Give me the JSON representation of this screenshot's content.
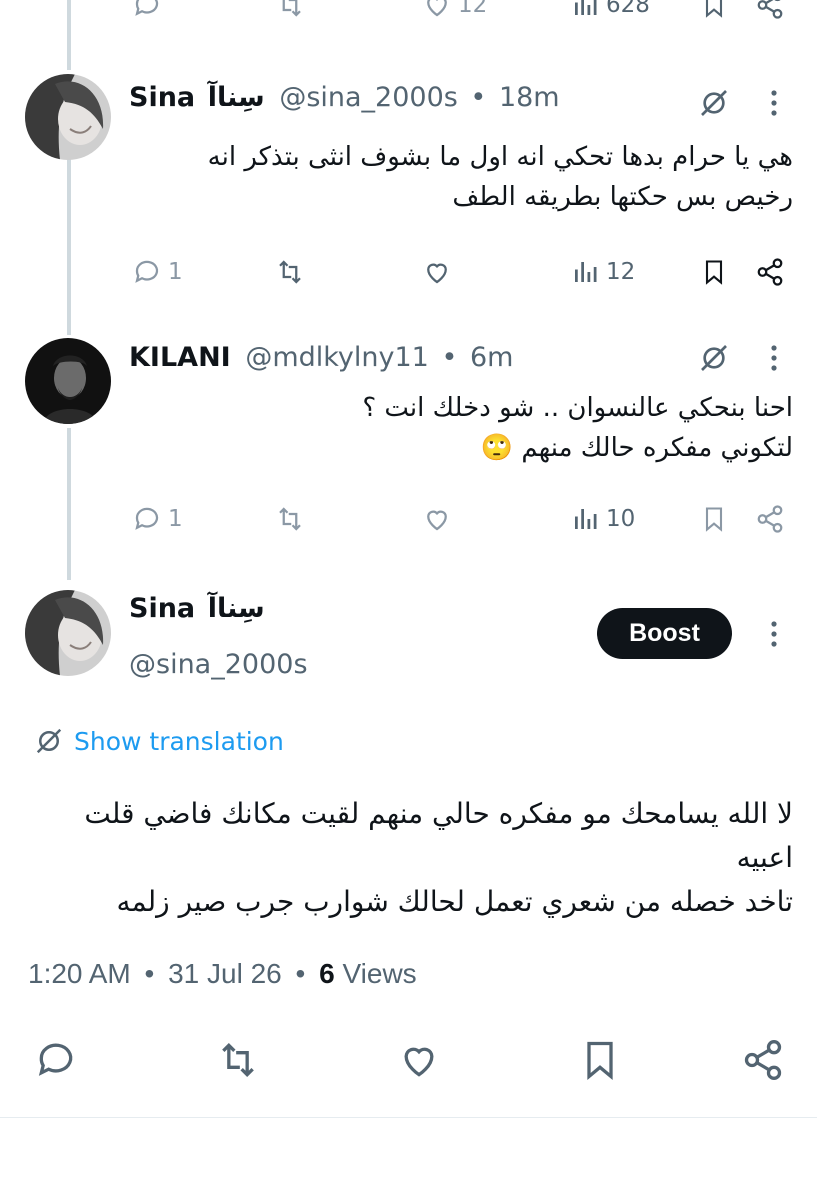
{
  "top_actions": {
    "likes": "12",
    "views": "628"
  },
  "replies": [
    {
      "display_name": "Sina",
      "display_name_ar": "سِناآ",
      "handle": "@sina_2000s",
      "separator": "•",
      "time": "18m",
      "text_lines": [
        "هي يا حرام بدها تحكي انه اول ما بشوف انثى بتذكر انه",
        "رخيص بس حكتها بطريقه الطف"
      ],
      "reply_count": "1",
      "views": "12"
    },
    {
      "display_name": "KILANI",
      "handle": "@mdlkylny11",
      "separator": "•",
      "time": "6m",
      "text_lines": [
        "احنا بنحكي عالنسوان .. شو دخلك انت ؟",
        "لتكوني مفكره حالك منهم 🙄"
      ],
      "reply_count": "1",
      "views": "10"
    }
  ],
  "main_tweet": {
    "display_name": "Sina",
    "display_name_ar": "سِناآ",
    "handle": "@sina_2000s",
    "boost_label": "Boost",
    "show_translation": "Show translation",
    "text_lines": [
      "لا الله يسامحك مو مفكره حالي منهم لقيت مكانك فاضي قلت",
      "اعبيه",
      "تاخد خصله من شعري تعمل لحالك شوارب جرب صير زلمه"
    ],
    "time": "1:20 AM",
    "date": "31 Jul 26",
    "views_count": "6",
    "views_label": "Views",
    "separator": "•"
  },
  "icons": [
    "reply-icon",
    "repost-icon",
    "like-icon",
    "views-icon",
    "bookmark-icon",
    "share-icon",
    "grok-icon",
    "more-icon",
    "translate-icon"
  ],
  "colors": {
    "accent": "#1d9bf0",
    "text": "#0f1419",
    "muted": "#536471",
    "icon_muted": "#8b98a5",
    "thread_line": "#cfd9de",
    "boost_bg": "#0f1419"
  }
}
